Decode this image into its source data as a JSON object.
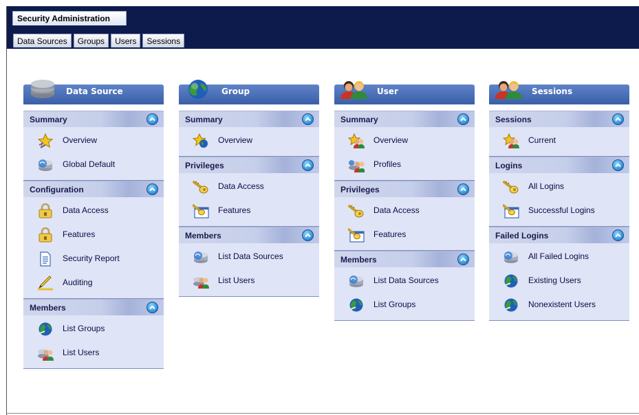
{
  "app_tab": "Security Administration",
  "subtabs": [
    "Data Sources",
    "Groups",
    "Users",
    "Sessions"
  ],
  "columns": [
    {
      "title": "Data Source",
      "icon": "database-icon",
      "sections": [
        {
          "title": "Summary",
          "items": [
            {
              "label": "Overview",
              "icon": "star-icon"
            },
            {
              "label": "Global Default",
              "icon": "server-icon"
            }
          ]
        },
        {
          "title": "Configuration",
          "items": [
            {
              "label": "Data Access",
              "icon": "lock-icon"
            },
            {
              "label": "Features",
              "icon": "lock-icon"
            },
            {
              "label": "Security Report",
              "icon": "document-icon"
            },
            {
              "label": "Auditing",
              "icon": "pen-icon"
            }
          ]
        },
        {
          "title": "Members",
          "items": [
            {
              "label": "List Groups",
              "icon": "globe-icon"
            },
            {
              "label": "List Users",
              "icon": "users-icon"
            }
          ]
        }
      ]
    },
    {
      "title": "Group",
      "icon": "globe-icon",
      "sections": [
        {
          "title": "Summary",
          "items": [
            {
              "label": "Overview",
              "icon": "star-globe-icon"
            }
          ]
        },
        {
          "title": "Privileges",
          "items": [
            {
              "label": "Data Access",
              "icon": "key-icon"
            },
            {
              "label": "Features",
              "icon": "key-window-icon"
            }
          ]
        },
        {
          "title": "Members",
          "items": [
            {
              "label": "List Data Sources",
              "icon": "server-icon"
            },
            {
              "label": "List Users",
              "icon": "users-icon"
            }
          ]
        }
      ]
    },
    {
      "title": "User",
      "icon": "users-icon",
      "sections": [
        {
          "title": "Summary",
          "items": [
            {
              "label": "Overview",
              "icon": "star-users-icon"
            },
            {
              "label": "Profiles",
              "icon": "users-server-icon"
            }
          ]
        },
        {
          "title": "Privileges",
          "items": [
            {
              "label": "Data Access",
              "icon": "key-icon"
            },
            {
              "label": "Features",
              "icon": "key-window-icon"
            }
          ]
        },
        {
          "title": "Members",
          "items": [
            {
              "label": "List Data Sources",
              "icon": "server-icon"
            },
            {
              "label": "List Groups",
              "icon": "globe-icon"
            }
          ]
        }
      ]
    },
    {
      "title": "Sessions",
      "icon": "users-icon",
      "sections": [
        {
          "title": "Sessions",
          "items": [
            {
              "label": "Current",
              "icon": "star-users-icon"
            }
          ]
        },
        {
          "title": "Logins",
          "items": [
            {
              "label": "All Logins",
              "icon": "key-icon"
            },
            {
              "label": "Successful Logins",
              "icon": "key-window-icon"
            }
          ]
        },
        {
          "title": "Failed Logins",
          "items": [
            {
              "label": "All Failed Logins",
              "icon": "server-icon"
            },
            {
              "label": "Existing Users",
              "icon": "globe-icon"
            },
            {
              "label": "Nonexistent Users",
              "icon": "globe-icon"
            }
          ]
        }
      ]
    }
  ]
}
